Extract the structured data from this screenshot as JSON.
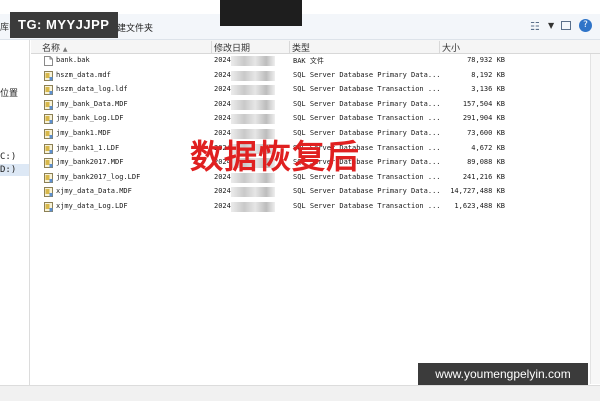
{
  "watermark_top": "TG: MYYJJPP",
  "watermark_bottom": "www.youmengpelyin.com",
  "toolbar": {
    "library_label": "库中",
    "new_folder_label": "新建文件夹"
  },
  "left_pane": {
    "item_location": "位置",
    "drive_c": "C:)",
    "drive_d": "D:)"
  },
  "columns": {
    "name": "名称",
    "date": "修改日期",
    "type": "类型",
    "size": "大小"
  },
  "overlay_text": "数据恢复后",
  "files": [
    {
      "name": "bank.bak",
      "date": "2024",
      "type": "BAK 文件",
      "size": "78,932 KB",
      "icon": "file-icon"
    },
    {
      "name": "hszm_data.mdf",
      "date": "2024",
      "type": "SQL Server Database Primary Data...",
      "size": "8,192 KB",
      "icon": "db-icon"
    },
    {
      "name": "hszm_data_log.ldf",
      "date": "2024",
      "type": "SQL Server Database Transaction ...",
      "size": "3,136 KB",
      "icon": "db-icon"
    },
    {
      "name": "jmy_bank_Data.MDF",
      "date": "2024",
      "type": "SQL Server Database Primary Data...",
      "size": "157,504 KB",
      "icon": "db-icon"
    },
    {
      "name": "jmy_bank_Log.LDF",
      "date": "2024",
      "type": "SQL Server Database Transaction ...",
      "size": "291,904 KB",
      "icon": "db-icon"
    },
    {
      "name": "jmy_bank1.MDF",
      "date": "2024",
      "type": "SQL Server Database Primary Data...",
      "size": "73,600 KB",
      "icon": "db-icon"
    },
    {
      "name": "jmy_bank1_1.LDF",
      "date": "2024",
      "type": "SQL Server Database Transaction ...",
      "size": "4,672 KB",
      "icon": "db-icon"
    },
    {
      "name": "jmy_bank2017.MDF",
      "date": "2024",
      "type": "SQL Server Database Primary Data...",
      "size": "89,088 KB",
      "icon": "db-icon"
    },
    {
      "name": "jmy_bank2017_log.LDF",
      "date": "2024",
      "type": "SQL Server Database Transaction ...",
      "size": "241,216 KB",
      "icon": "db-icon"
    },
    {
      "name": "xjmy_data_Data.MDF",
      "date": "2024",
      "type": "SQL Server Database Primary Data...",
      "size": "14,727,488 KB",
      "icon": "db-icon"
    },
    {
      "name": "xjmy_data_Log.LDF",
      "date": "2024",
      "type": "SQL Server Database Transaction ...",
      "size": "1,623,488 KB",
      "icon": "db-icon"
    }
  ]
}
